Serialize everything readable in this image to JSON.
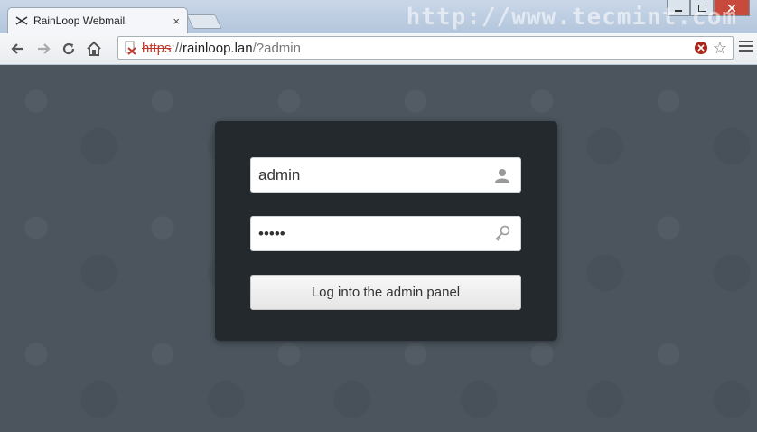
{
  "browser": {
    "tab_title": "RainLoop Webmail",
    "tab_close": "×",
    "watermark": "http://www.tecmint.com",
    "address": {
      "scheme": "https",
      "separator": "://",
      "host": "rainloop.lan",
      "path": "/?admin"
    },
    "icons": {
      "back": "back-arrow-icon",
      "forward": "forward-arrow-icon",
      "reload": "reload-icon",
      "home": "home-icon",
      "star": "bookmark-star-icon",
      "menu": "chrome-menu-icon"
    }
  },
  "login": {
    "username_value": "admin",
    "password_value": "•••••",
    "submit_label": "Log into the admin panel"
  },
  "colors": {
    "page_bg": "#4b545d",
    "card_bg": "#24292d",
    "insecure_red": "#c0392b"
  }
}
